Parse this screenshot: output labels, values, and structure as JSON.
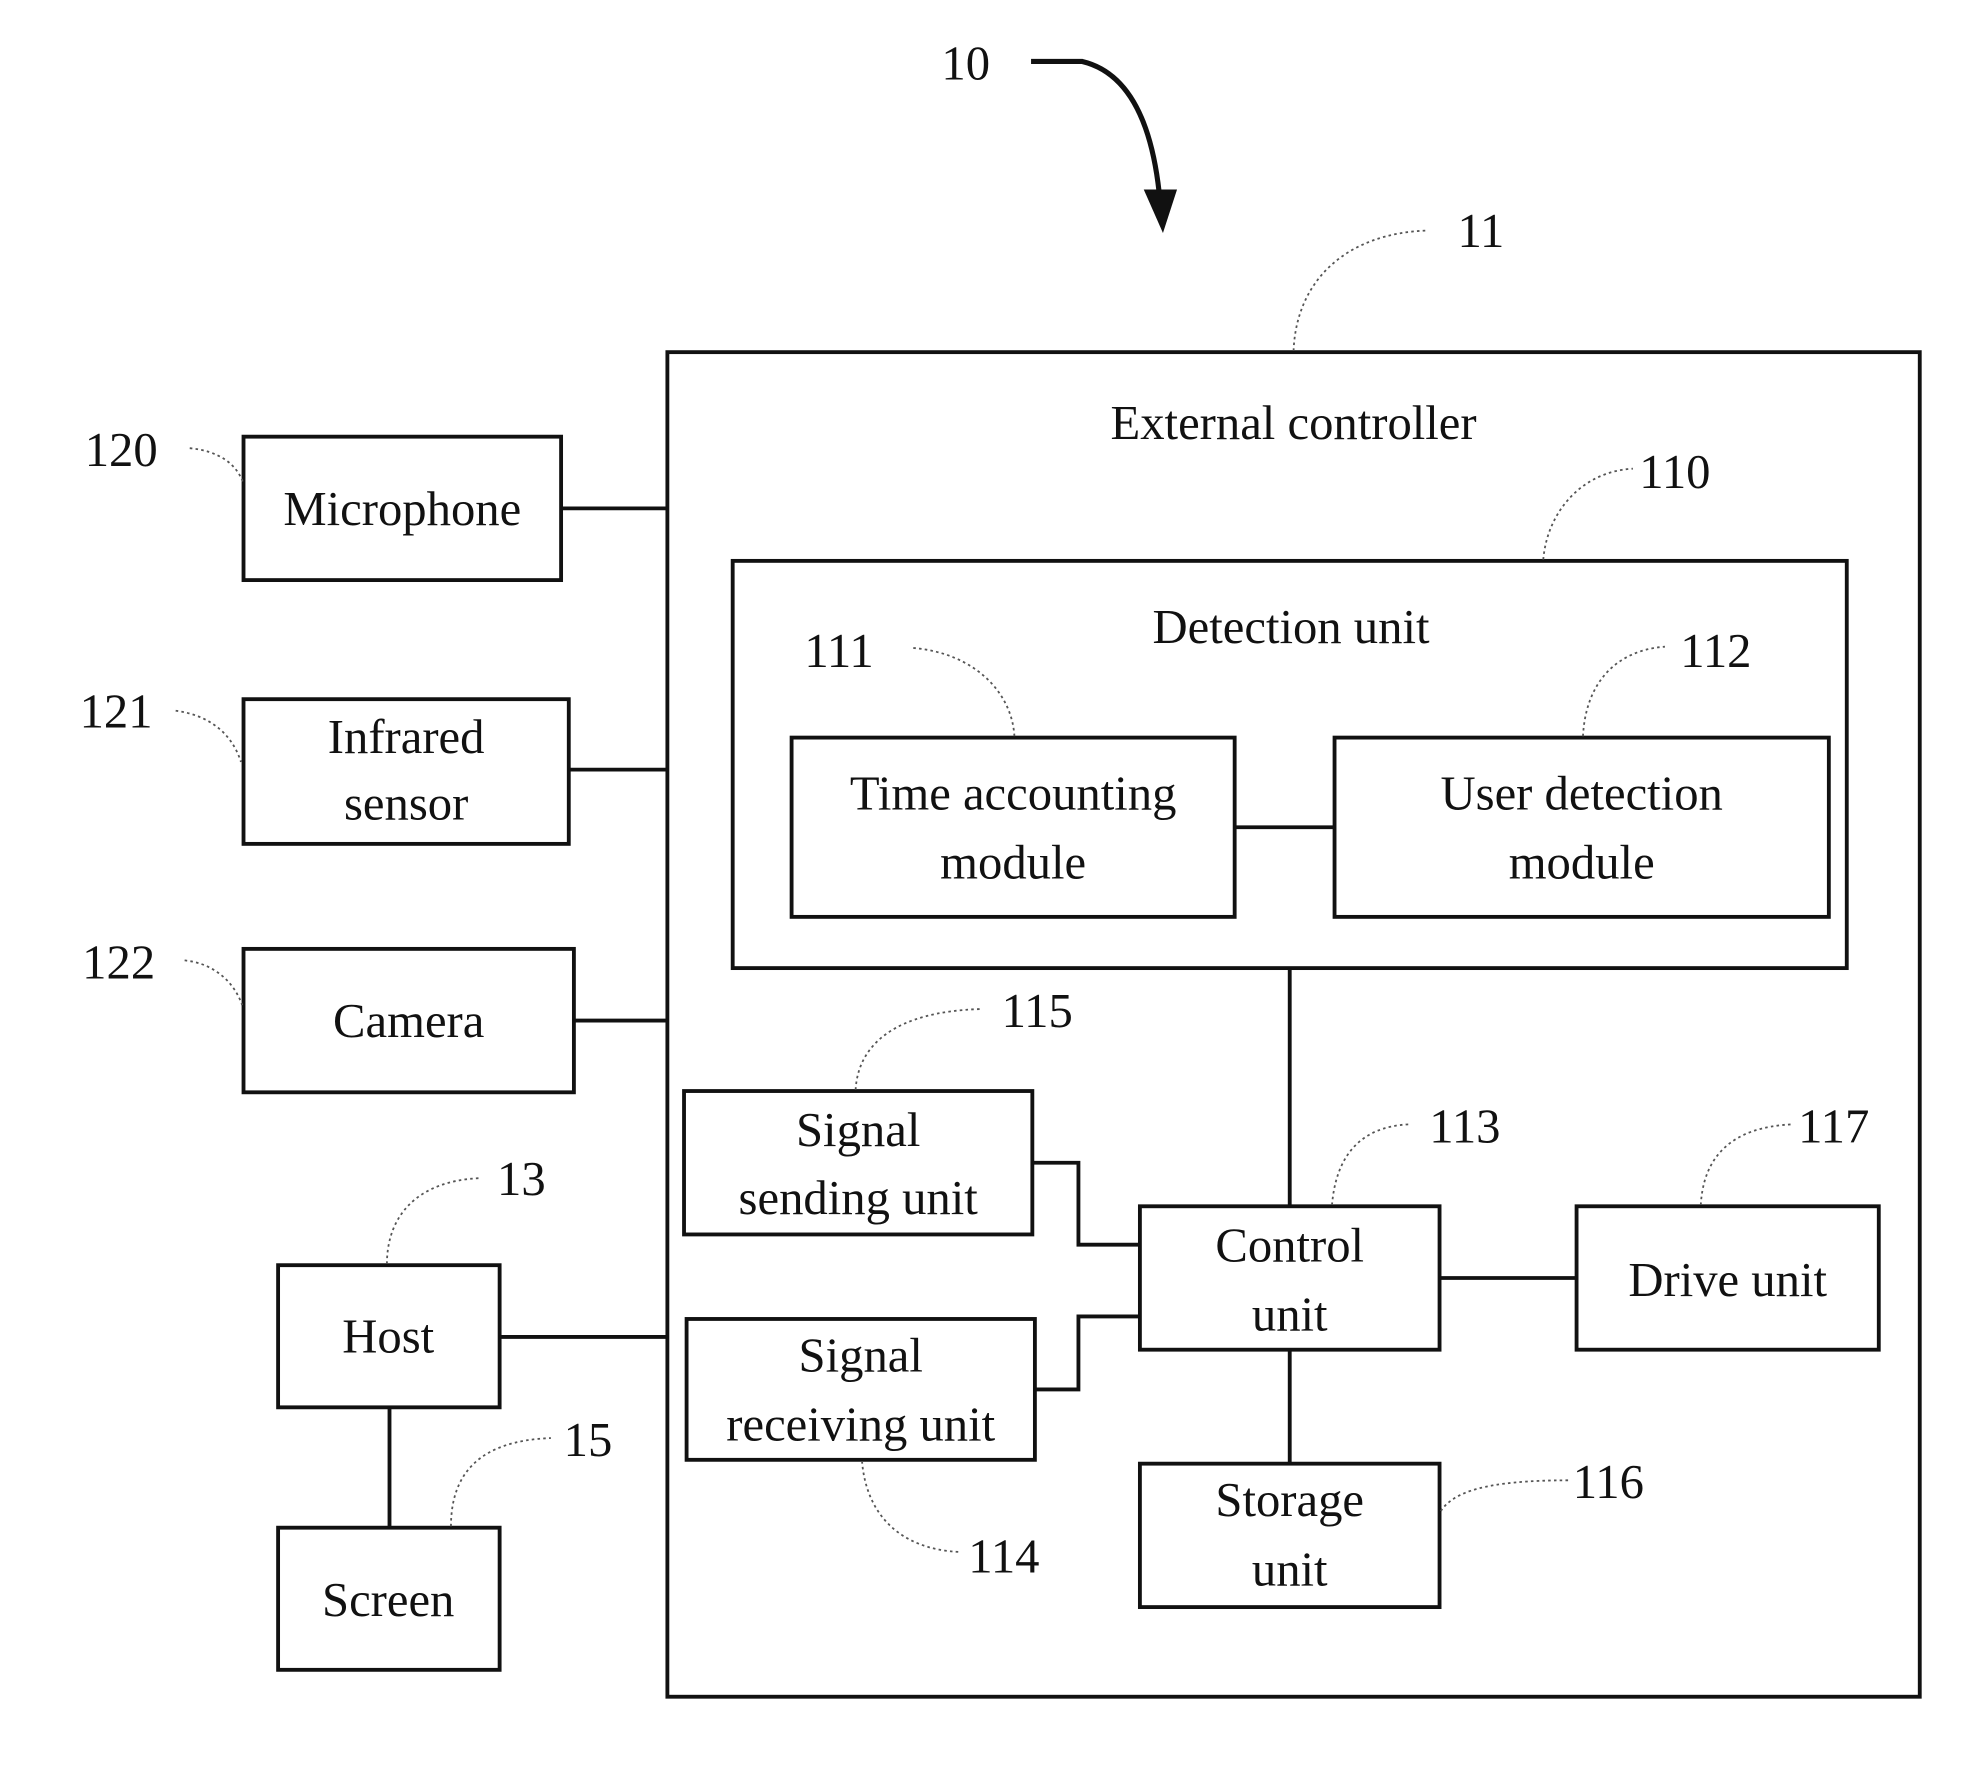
{
  "diagram": {
    "system_ref": "10",
    "external_controller": {
      "ref": "11",
      "label": "External controller"
    },
    "detection_unit": {
      "ref": "110",
      "label": "Detection unit"
    },
    "time_accounting_module": {
      "ref": "111",
      "line1": "Time accounting",
      "line2": "module"
    },
    "user_detection_module": {
      "ref": "112",
      "line1": "User detection",
      "line2": "module"
    },
    "control_unit": {
      "ref": "113",
      "line1": "Control",
      "line2": "unit"
    },
    "signal_receiving_unit": {
      "ref": "114",
      "line1": "Signal",
      "line2": "receiving unit"
    },
    "signal_sending_unit": {
      "ref": "115",
      "line1": "Signal",
      "line2": "sending unit"
    },
    "storage_unit": {
      "ref": "116",
      "line1": "Storage",
      "line2": "unit"
    },
    "drive_unit": {
      "ref": "117",
      "label": "Drive unit"
    },
    "microphone": {
      "ref": "120",
      "label": "Microphone"
    },
    "infrared_sensor": {
      "ref": "121",
      "line1": "Infrared",
      "line2": "sensor"
    },
    "camera": {
      "ref": "122",
      "label": "Camera"
    },
    "host": {
      "ref": "13",
      "label": "Host"
    },
    "screen": {
      "ref": "15",
      "label": "Screen"
    }
  }
}
